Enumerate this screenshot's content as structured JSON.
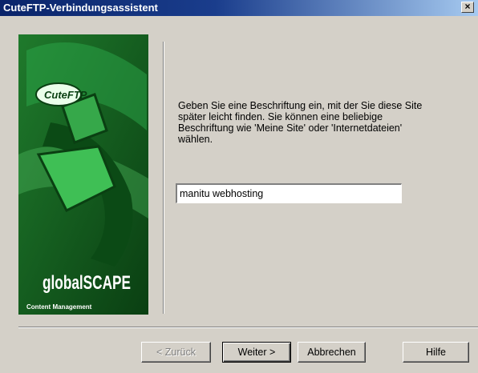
{
  "window": {
    "title": "CuteFTP-Verbindungsassistent",
    "close_glyph": "×"
  },
  "banner": {
    "product_logo": "CuteFTP",
    "company_logo": "globalSCAPE",
    "tagline": "Content Management",
    "colors": {
      "background": "#0f5a1a",
      "accent": "#2ca84a"
    }
  },
  "main": {
    "description_lines": [
      "Geben Sie eine Beschriftung ein, mit der Sie diese Site",
      "später leicht finden. Sie können eine beliebige",
      "Beschriftung wie 'Meine Site' oder 'Internetdateien'",
      "wählen."
    ],
    "site_label_value": "manitu webhosting"
  },
  "buttons": {
    "back": "< Zurück",
    "next": "Weiter >",
    "cancel": "Abbrechen",
    "help": "Hilfe"
  }
}
